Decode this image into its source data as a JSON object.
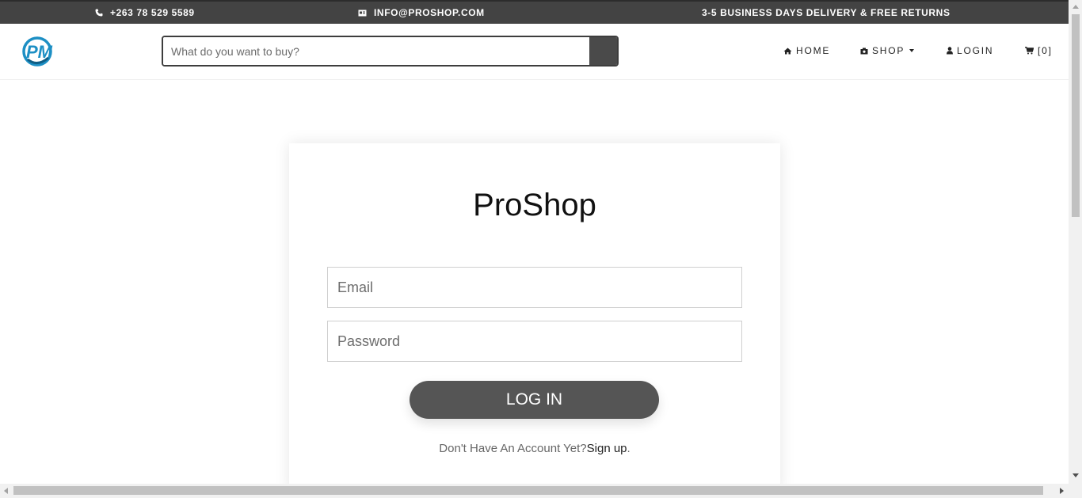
{
  "topbar": {
    "phone": "+263 78 529 5589",
    "email": "INFO@PROSHOP.COM",
    "delivery": "3-5 BUSINESS DAYS DELIVERY & FREE RETURNS"
  },
  "header": {
    "logo_text": "PM",
    "search_placeholder": "What do you want to buy?",
    "nav": {
      "home": "HOME",
      "shop": "SHOP",
      "login": "LOGIN",
      "cart": "[0]"
    }
  },
  "login": {
    "brand": "ProShop",
    "email_placeholder": "Email",
    "password_placeholder": "Password",
    "button": "LOG IN",
    "signup_prompt": "Don't Have An Account Yet?",
    "signup_link": "Sign up",
    "signup_suffix": "."
  },
  "colors": {
    "topbar_bg": "#434343",
    "button_bg": "#555555",
    "logo_blue": "#1d8fc4"
  },
  "icons": [
    "phone-icon",
    "email-icon",
    "home-icon",
    "shop-icon",
    "user-icon",
    "cart-icon",
    "search-icon"
  ]
}
